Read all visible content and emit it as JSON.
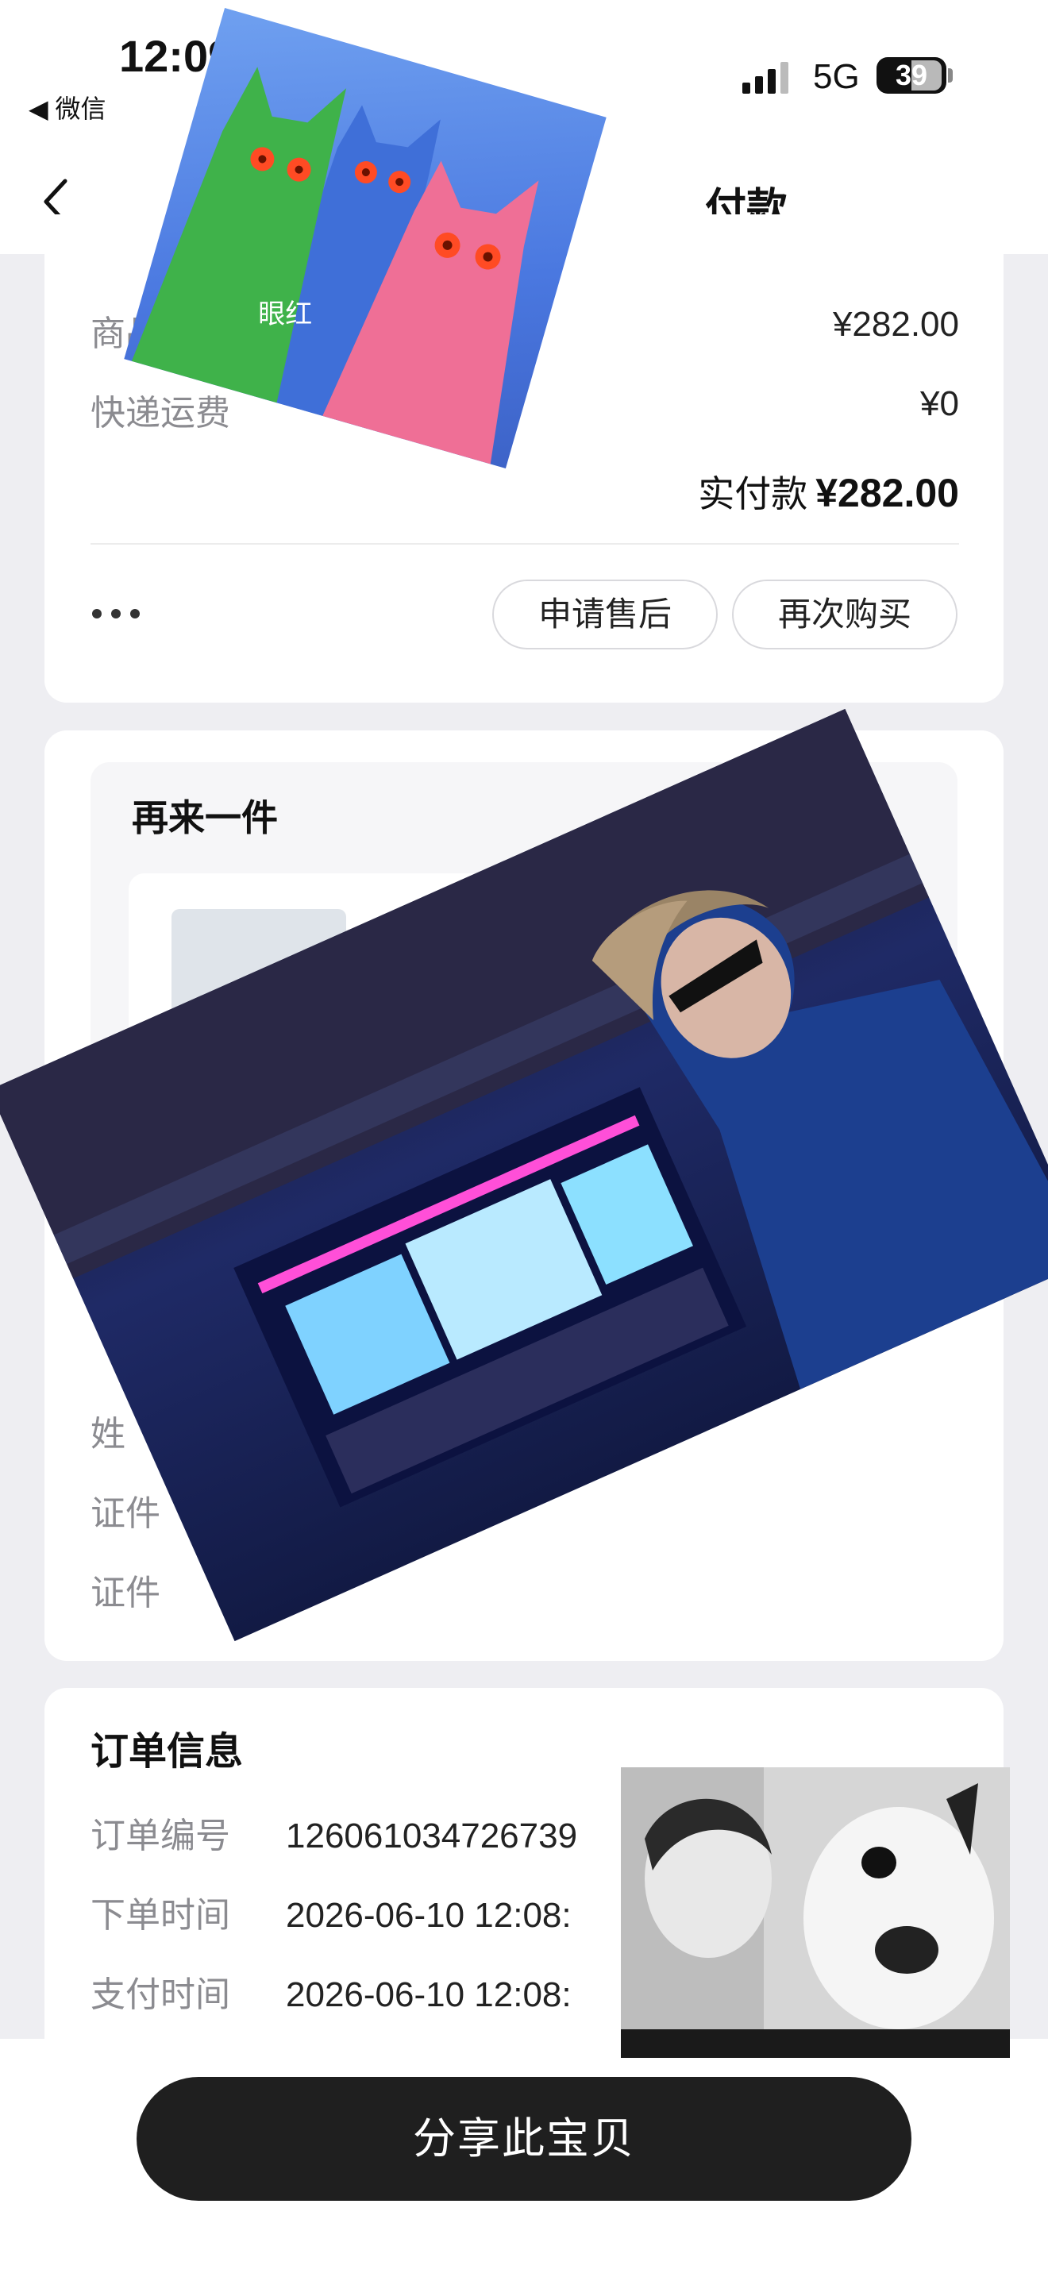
{
  "status_bar": {
    "time": "12:09",
    "back_app": "◀ 微信",
    "network": "5G",
    "battery": "39"
  },
  "nav": {
    "title": "付款"
  },
  "amounts": {
    "goods_label": "商品",
    "goods_value": "¥282.00",
    "shipping_label": "快递运费",
    "shipping_value": "¥0",
    "paid_label": "实付款",
    "paid_value": "¥282.00",
    "after_sale_button": "申请售后",
    "rebuy_button": "再次购买"
  },
  "repurchase": {
    "title": "再来一件",
    "labels": [
      "姓",
      "证件",
      "证件"
    ]
  },
  "order": {
    "title": "订单信息",
    "rows": [
      {
        "label": "订单编号",
        "value": "126061034726739"
      },
      {
        "label": "下单时间",
        "value": "2026-06-10 12:08:"
      },
      {
        "label": "支付时间",
        "value": "2026-06-10 12:08:"
      }
    ]
  },
  "bottom": {
    "share_button": "分享此宝贝"
  },
  "stickers": {
    "cats_caption": "眼红"
  },
  "colors": {
    "background": "#eeeef2",
    "card": "#ffffff",
    "primary_button": "#1f1f1f"
  }
}
